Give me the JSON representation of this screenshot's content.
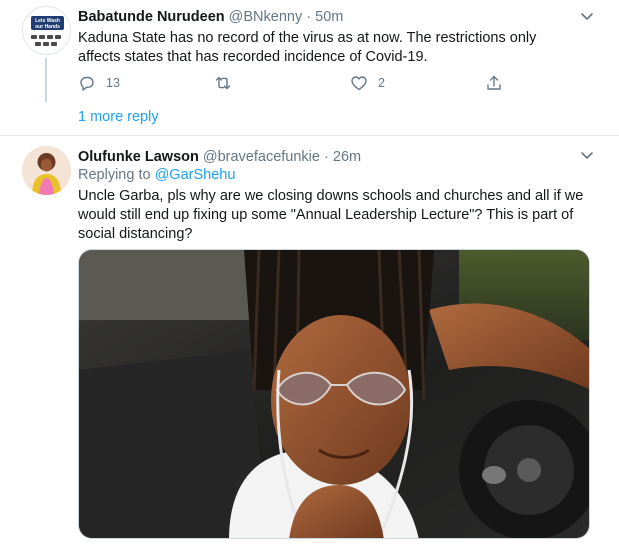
{
  "tweets": [
    {
      "avatar_icon": "lets-wash-our-hands-avatar",
      "avatar_text": "Lets Wash our Hands",
      "name": "Babatunde Nurudeen",
      "handle": "@BNkenny",
      "separator": "·",
      "time": "50m",
      "text": "Kaduna State has no record of the virus as at now. The restrictions only affects states that has recorded incidence of Covid-19.",
      "reply_count": "13",
      "retweet_count": "",
      "like_count": "2",
      "more_replies": "1 more reply"
    },
    {
      "avatar_icon": "profile-photo-avatar",
      "name": "Olufunke Lawson",
      "handle": "@bravefacefunkie",
      "separator": "·",
      "time": "26m",
      "replying_prefix": "Replying to",
      "replying_handle": "@GarShehu",
      "text": "Uncle Garba, pls why are we closing downs schools and churches and all if we would still end up fixing up some \"Annual Leadership Lecture\"? This is part of social distancing?",
      "media_icon": "attached-photo"
    }
  ],
  "colors": {
    "accent": "#1da1f2",
    "secondary_text": "#657786",
    "border": "#e6ecf0"
  }
}
